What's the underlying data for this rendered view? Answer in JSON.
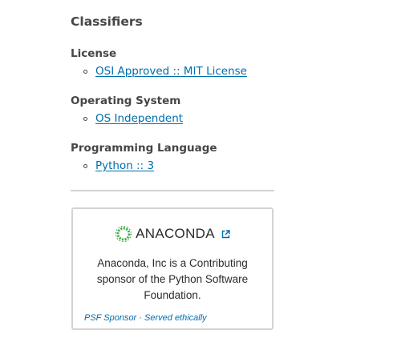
{
  "classifiers": {
    "heading": "Classifiers",
    "groups": [
      {
        "title": "License",
        "items": [
          "OSI Approved :: MIT License"
        ]
      },
      {
        "title": "Operating System",
        "items": [
          "OS Independent"
        ]
      },
      {
        "title": "Programming Language",
        "items": [
          "Python :: 3"
        ]
      }
    ]
  },
  "sponsor": {
    "logo_text": "ANACONDA",
    "logo_icon": "anaconda-ring-logo",
    "external_icon": "external-link-icon",
    "description": "Anaconda, Inc is a Contributing sponsor of the Python Software Foundation.",
    "footer_sponsor": "PSF Sponsor",
    "footer_separator": "·",
    "footer_ethical": "Served ethically"
  },
  "colors": {
    "link": "#006dad",
    "text": "#464646",
    "divider": "#d3d3d3",
    "logo_green": "#43b049"
  }
}
